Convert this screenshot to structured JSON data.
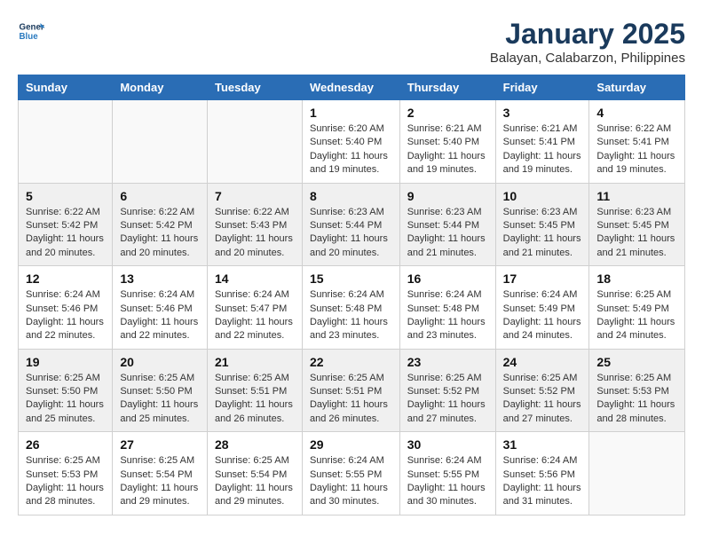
{
  "logo": {
    "general": "General",
    "blue": "Blue"
  },
  "title": "January 2025",
  "subtitle": "Balayan, Calabarzon, Philippines",
  "weekdays": [
    "Sunday",
    "Monday",
    "Tuesday",
    "Wednesday",
    "Thursday",
    "Friday",
    "Saturday"
  ],
  "weeks": [
    [
      {
        "day": null
      },
      {
        "day": null
      },
      {
        "day": null
      },
      {
        "day": 1,
        "sunrise": "6:20 AM",
        "sunset": "5:40 PM",
        "daylight": "11 hours and 19 minutes."
      },
      {
        "day": 2,
        "sunrise": "6:21 AM",
        "sunset": "5:40 PM",
        "daylight": "11 hours and 19 minutes."
      },
      {
        "day": 3,
        "sunrise": "6:21 AM",
        "sunset": "5:41 PM",
        "daylight": "11 hours and 19 minutes."
      },
      {
        "day": 4,
        "sunrise": "6:22 AM",
        "sunset": "5:41 PM",
        "daylight": "11 hours and 19 minutes."
      }
    ],
    [
      {
        "day": 5,
        "sunrise": "6:22 AM",
        "sunset": "5:42 PM",
        "daylight": "11 hours and 20 minutes."
      },
      {
        "day": 6,
        "sunrise": "6:22 AM",
        "sunset": "5:42 PM",
        "daylight": "11 hours and 20 minutes."
      },
      {
        "day": 7,
        "sunrise": "6:22 AM",
        "sunset": "5:43 PM",
        "daylight": "11 hours and 20 minutes."
      },
      {
        "day": 8,
        "sunrise": "6:23 AM",
        "sunset": "5:44 PM",
        "daylight": "11 hours and 20 minutes."
      },
      {
        "day": 9,
        "sunrise": "6:23 AM",
        "sunset": "5:44 PM",
        "daylight": "11 hours and 21 minutes."
      },
      {
        "day": 10,
        "sunrise": "6:23 AM",
        "sunset": "5:45 PM",
        "daylight": "11 hours and 21 minutes."
      },
      {
        "day": 11,
        "sunrise": "6:23 AM",
        "sunset": "5:45 PM",
        "daylight": "11 hours and 21 minutes."
      }
    ],
    [
      {
        "day": 12,
        "sunrise": "6:24 AM",
        "sunset": "5:46 PM",
        "daylight": "11 hours and 22 minutes."
      },
      {
        "day": 13,
        "sunrise": "6:24 AM",
        "sunset": "5:46 PM",
        "daylight": "11 hours and 22 minutes."
      },
      {
        "day": 14,
        "sunrise": "6:24 AM",
        "sunset": "5:47 PM",
        "daylight": "11 hours and 22 minutes."
      },
      {
        "day": 15,
        "sunrise": "6:24 AM",
        "sunset": "5:48 PM",
        "daylight": "11 hours and 23 minutes."
      },
      {
        "day": 16,
        "sunrise": "6:24 AM",
        "sunset": "5:48 PM",
        "daylight": "11 hours and 23 minutes."
      },
      {
        "day": 17,
        "sunrise": "6:24 AM",
        "sunset": "5:49 PM",
        "daylight": "11 hours and 24 minutes."
      },
      {
        "day": 18,
        "sunrise": "6:25 AM",
        "sunset": "5:49 PM",
        "daylight": "11 hours and 24 minutes."
      }
    ],
    [
      {
        "day": 19,
        "sunrise": "6:25 AM",
        "sunset": "5:50 PM",
        "daylight": "11 hours and 25 minutes."
      },
      {
        "day": 20,
        "sunrise": "6:25 AM",
        "sunset": "5:50 PM",
        "daylight": "11 hours and 25 minutes."
      },
      {
        "day": 21,
        "sunrise": "6:25 AM",
        "sunset": "5:51 PM",
        "daylight": "11 hours and 26 minutes."
      },
      {
        "day": 22,
        "sunrise": "6:25 AM",
        "sunset": "5:51 PM",
        "daylight": "11 hours and 26 minutes."
      },
      {
        "day": 23,
        "sunrise": "6:25 AM",
        "sunset": "5:52 PM",
        "daylight": "11 hours and 27 minutes."
      },
      {
        "day": 24,
        "sunrise": "6:25 AM",
        "sunset": "5:52 PM",
        "daylight": "11 hours and 27 minutes."
      },
      {
        "day": 25,
        "sunrise": "6:25 AM",
        "sunset": "5:53 PM",
        "daylight": "11 hours and 28 minutes."
      }
    ],
    [
      {
        "day": 26,
        "sunrise": "6:25 AM",
        "sunset": "5:53 PM",
        "daylight": "11 hours and 28 minutes."
      },
      {
        "day": 27,
        "sunrise": "6:25 AM",
        "sunset": "5:54 PM",
        "daylight": "11 hours and 29 minutes."
      },
      {
        "day": 28,
        "sunrise": "6:25 AM",
        "sunset": "5:54 PM",
        "daylight": "11 hours and 29 minutes."
      },
      {
        "day": 29,
        "sunrise": "6:24 AM",
        "sunset": "5:55 PM",
        "daylight": "11 hours and 30 minutes."
      },
      {
        "day": 30,
        "sunrise": "6:24 AM",
        "sunset": "5:55 PM",
        "daylight": "11 hours and 30 minutes."
      },
      {
        "day": 31,
        "sunrise": "6:24 AM",
        "sunset": "5:56 PM",
        "daylight": "11 hours and 31 minutes."
      },
      {
        "day": null
      }
    ]
  ]
}
